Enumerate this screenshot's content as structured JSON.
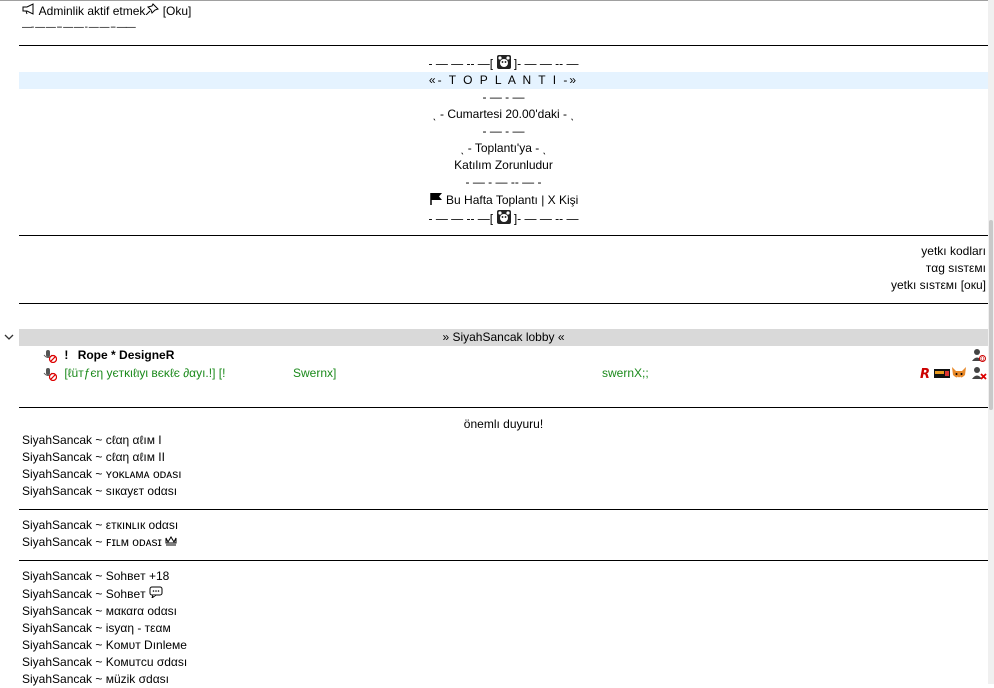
{
  "top": {
    "admin_line": "Adminlik aktif etmek",
    "admin_suffix": "[Oku]",
    "dash_line": "—- — — -- — — - — — -- ——"
  },
  "meeting": {
    "deco_top": "- — — -- —[",
    "deco_top_end": "]- — — -- —",
    "title": "«- T O P L A N T I -»",
    "deco_1": "- — - —",
    "time_line": "ˎ - Cumartesi 20.00'daki - ˎ",
    "deco_2": "- — - —",
    "toplanti_line": "ˎ - Toplantı'ya  - ˎ",
    "katilim": "Katılım Zorunludur",
    "deco_3": "- — - — -- — -",
    "week_line": "Bu Hafta Toplantı | X Kişi",
    "deco_bottom": "- — — -- —[",
    "deco_bottom_end": "]- — — -- —"
  },
  "right_links": [
    "yetkı kodları",
    "тαg ѕıѕтεмı",
    "yetkı ѕıѕтεмı [oкu]"
  ],
  "lobby": {
    "category": "» SiyahSancak lobby «",
    "user1_prefix": "!",
    "user1_name": "Rope * DesigneR",
    "user2_text_a": "[ℓüтƒєη уєтĸιℓιуι вєĸℓє ∂αуı.!] [!",
    "user2_text_b": "Swernx]",
    "user2_text_c": "swernX;;"
  },
  "announce": {
    "title": "önemlı duyuru!",
    "items": [
      "SiyahSancak ~ cℓαη αℓıм I",
      "SiyahSancak ~ cℓαη αℓıм II",
      "SiyahSancak ~ ʏᴏᴋʟᴀᴍᴀ ᴏᴅᴀsı",
      "SiyahSancak ~ ѕıкαуεт odαѕı"
    ]
  },
  "events": {
    "items": [
      "SiyahSancak ~ εткıɴʟıк odαѕı",
      "SiyahSancak ~ ꜰɪʟᴍ ᴏᴅᴀѕɪ"
    ]
  },
  "rooms": {
    "items": [
      "SiyahSancak ~ Sohвeт +18",
      "SiyahSancak ~ Sohвeт",
      "SiyahSancak ~ мαкαrα odαѕı",
      "SiyahSancak ~ isyαη - тεαм",
      "SiyahSancak ~ Koмυт Dınleмe",
      "SiyahSancak ~ Koмuтcu σdαsı",
      "SiyahSancak ~ мüzik σdαsı"
    ]
  }
}
